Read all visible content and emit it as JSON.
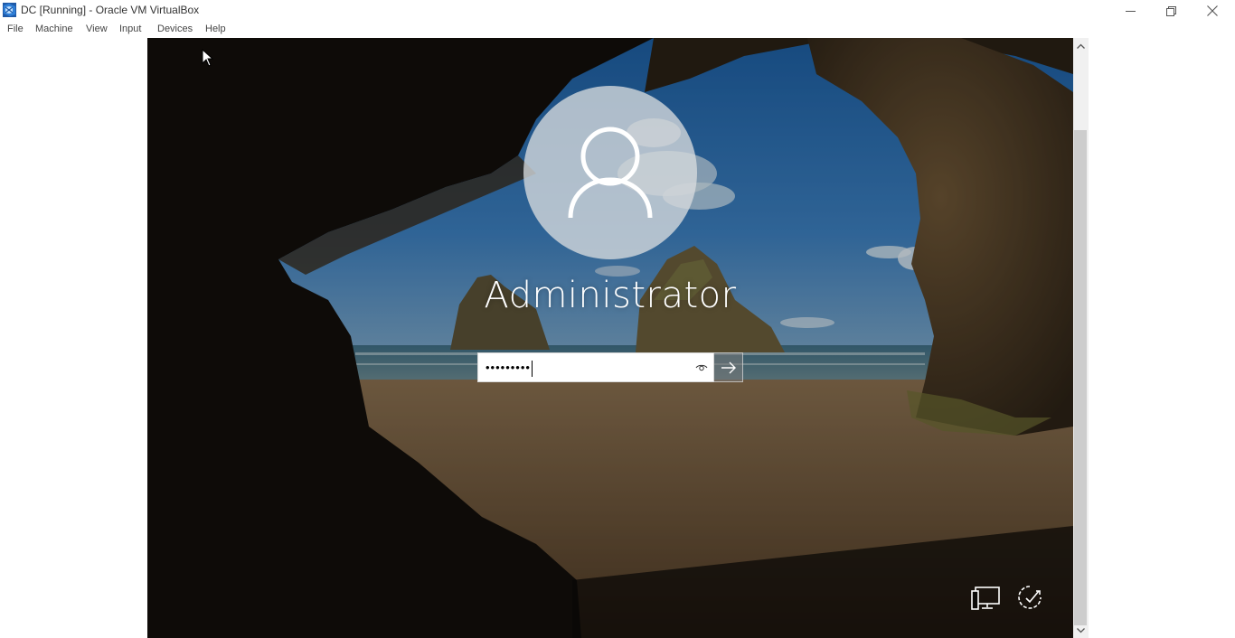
{
  "window": {
    "title": "DC [Running] - Oracle VM VirtualBox",
    "app_icon": "virtualbox-icon",
    "controls": [
      "minimize-icon",
      "restore-icon",
      "close-icon"
    ]
  },
  "menu": {
    "items": [
      {
        "label": "File"
      },
      {
        "label": "Machine"
      },
      {
        "label": "View"
      },
      {
        "label": "Input"
      },
      {
        "label": "Devices"
      },
      {
        "label": "Help"
      }
    ]
  },
  "login": {
    "user_name": "Administrator",
    "password_masked": "•••••••••",
    "avatar_icon": "user-avatar-icon",
    "reveal_icon": "eye-icon",
    "submit_icon": "arrow-right-icon",
    "network_icon": "network-icon",
    "power_icon": "power-icon"
  },
  "colors": {
    "title_text": "#333333",
    "menu_text": "#444444",
    "scrollbar_track": "#f0f0f0",
    "scrollbar_thumb": "#cdcdcd"
  }
}
